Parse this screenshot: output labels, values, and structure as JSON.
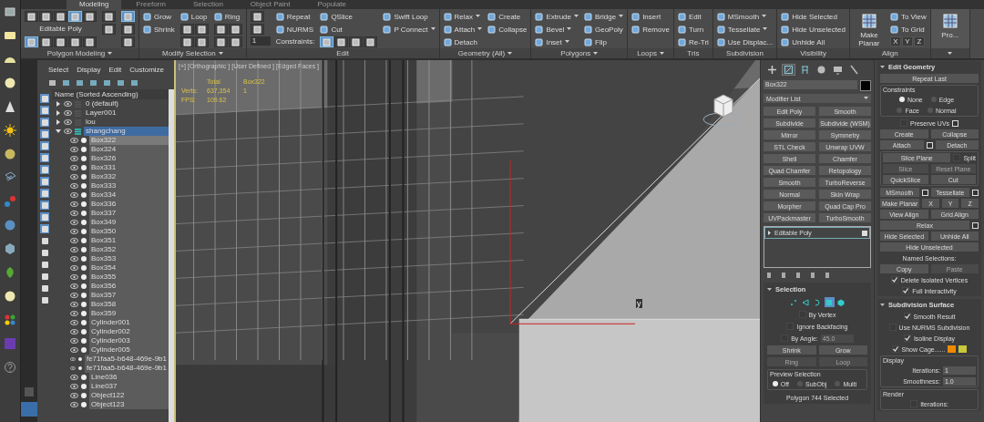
{
  "ribbon": {
    "tabs": [
      {
        "label": "Modeling",
        "selected": true
      },
      {
        "label": "Freeform",
        "selected": false
      },
      {
        "label": "Selection",
        "selected": false
      },
      {
        "label": "Object Paint",
        "selected": false
      },
      {
        "label": "Populate",
        "selected": false
      }
    ],
    "panels": [
      {
        "title": "Polygon Modeling",
        "dropdown": true,
        "columns": [
          [
            {
              "kind": "icons",
              "icons": [
                {
                  "selected": false
                },
                {
                  "selected": false
                },
                {
                  "selected": false
                },
                {
                  "selected": true
                },
                {
                  "selected": false
                }
              ]
            },
            {
              "kind": "text",
              "label": "Editable Poly"
            },
            {
              "kind": "icons",
              "icons": [
                {
                  "selected": true
                },
                {
                  "selected": false
                },
                {
                  "selected": false
                },
                {
                  "selected": false
                },
                {
                  "selected": false
                }
              ]
            }
          ],
          [
            {
              "kind": "icons",
              "icons": [
                {
                  "selected": false
                }
              ]
            },
            {
              "kind": "icons",
              "icons": [
                {
                  "selected": false
                }
              ]
            }
          ],
          [
            {
              "kind": "icons",
              "icons": [
                {
                  "selected": true
                }
              ]
            },
            {
              "kind": "icons",
              "icons": [
                {
                  "selected": false
                }
              ]
            },
            {
              "kind": "icons",
              "icons": [
                {
                  "selected": false
                }
              ]
            }
          ]
        ]
      },
      {
        "title": "Modify Selection",
        "dropdown": true,
        "columns": [
          [
            {
              "kind": "tool",
              "label": "Grow"
            },
            {
              "kind": "tool",
              "label": "Shrink"
            }
          ],
          [
            {
              "kind": "tool",
              "label": "Loop"
            },
            {
              "kind": "icons",
              "icons": [
                {
                  "selected": false
                },
                {
                  "selected": false
                }
              ]
            },
            {
              "kind": "icons",
              "icons": [
                {
                  "selected": false
                },
                {
                  "selected": false
                }
              ]
            }
          ],
          [
            {
              "kind": "tool",
              "label": "Ring"
            },
            {
              "kind": "icons",
              "icons": [
                {
                  "selected": false
                },
                {
                  "selected": false
                }
              ]
            },
            {
              "kind": "icons",
              "icons": [
                {
                  "selected": false
                },
                {
                  "selected": false
                }
              ]
            }
          ]
        ]
      },
      {
        "title": "Edit",
        "columns": [
          [
            {
              "kind": "icons",
              "icons": [
                {
                  "selected": false
                }
              ]
            },
            {
              "kind": "icons",
              "icons": [
                {
                  "selected": false
                }
              ]
            },
            {
              "kind": "spinner",
              "value": "1"
            }
          ],
          [
            {
              "kind": "tool",
              "label": "Repeat"
            },
            {
              "kind": "tool",
              "label": "NURMS"
            },
            {
              "kind": "text",
              "label": "Constraints:"
            }
          ],
          [
            {
              "kind": "tool",
              "label": "QSlice"
            },
            {
              "kind": "tool",
              "label": "Cut"
            },
            {
              "kind": "icons",
              "icons": [
                {
                  "selected": true
                },
                {
                  "selected": false
                },
                {
                  "selected": false
                },
                {
                  "selected": false
                }
              ]
            }
          ],
          [
            {
              "kind": "tool",
              "label": "Swift Loop"
            },
            {
              "kind": "tool",
              "label": "P Connect",
              "dropdown": true
            }
          ]
        ]
      },
      {
        "title": "Geometry (All)",
        "dropdown": true,
        "columns": [
          [
            {
              "kind": "tool",
              "label": "Relax",
              "dropdown": true
            },
            {
              "kind": "tool",
              "label": "Attach",
              "dropdown": true
            },
            {
              "kind": "tool",
              "label": "Detach"
            }
          ],
          [
            {
              "kind": "tool",
              "label": "Create"
            },
            {
              "kind": "tool",
              "label": "Collapse"
            }
          ]
        ]
      },
      {
        "title": "Polygons",
        "dropdown": true,
        "columns": [
          [
            {
              "kind": "tool",
              "label": "Extrude",
              "dropdown": true
            },
            {
              "kind": "tool",
              "label": "Bevel",
              "dropdown": true
            },
            {
              "kind": "tool",
              "label": "Inset",
              "dropdown": true
            }
          ],
          [
            {
              "kind": "tool",
              "label": "Bridge",
              "dropdown": true
            },
            {
              "kind": "tool",
              "label": "GeoPoly"
            },
            {
              "kind": "tool",
              "label": "Flip"
            }
          ]
        ]
      },
      {
        "title": "Loops",
        "dropdown": true,
        "columns": [
          [
            {
              "kind": "tool",
              "label": "Insert"
            },
            {
              "kind": "tool",
              "label": "Remove"
            }
          ]
        ]
      },
      {
        "title": "Tris",
        "columns": [
          [
            {
              "kind": "tool",
              "label": "Edit"
            },
            {
              "kind": "tool",
              "label": "Turn"
            },
            {
              "kind": "tool",
              "label": "Re-Tri"
            }
          ]
        ]
      },
      {
        "title": "Subdivision",
        "columns": [
          [
            {
              "kind": "tool",
              "label": "MSmooth",
              "dropdown": true
            },
            {
              "kind": "tool",
              "label": "Tessellate",
              "dropdown": true
            },
            {
              "kind": "tool",
              "label": "Use Displac..."
            }
          ]
        ]
      },
      {
        "title": "Visibility",
        "columns": [
          [
            {
              "kind": "tool",
              "label": "Hide Selected"
            },
            {
              "kind": "tool",
              "label": "Hide Unselected"
            },
            {
              "kind": "tool",
              "label": "Unhide All"
            }
          ]
        ]
      },
      {
        "title": "Align",
        "columns": [
          [
            {
              "kind": "big",
              "label": "Make Planar"
            }
          ],
          [
            {
              "kind": "tool",
              "label": "To View"
            },
            {
              "kind": "tool",
              "label": "To Grid"
            },
            {
              "kind": "axes",
              "labels": [
                "X",
                "Y",
                "Z"
              ]
            }
          ]
        ]
      },
      {
        "dropdown": true,
        "columns": [
          [
            {
              "kind": "big",
              "label": "Pro..."
            }
          ]
        ]
      }
    ]
  },
  "scene_explorer": {
    "menu": [
      "Select",
      "Display",
      "Edit",
      "Customize"
    ],
    "column_header": "Name (Sorted Ascending)",
    "filters": [
      {
        "on": true
      },
      {
        "on": true
      },
      {
        "on": true
      },
      {
        "on": true
      },
      {
        "on": true
      },
      {
        "on": true
      },
      {
        "on": true
      },
      {
        "on": true
      },
      {
        "on": true
      },
      {
        "on": true
      },
      {
        "on": true
      },
      {
        "on": true
      },
      {
        "on": false
      },
      {
        "on": false
      },
      {
        "on": false
      },
      {
        "on": false
      },
      {
        "on": false
      },
      {
        "on": false
      }
    ],
    "layers": [
      {
        "name": "0 (default)",
        "expanded": false,
        "selected": false
      },
      {
        "name": "Layer001",
        "expanded": false,
        "selected": false
      },
      {
        "name": "lou",
        "expanded": false,
        "selected": false
      },
      {
        "name": "shangchang",
        "expanded": true,
        "selected": true,
        "children": [
          {
            "name": "Box322",
            "selected": true
          },
          {
            "name": "Box324",
            "selected": false
          },
          {
            "name": "Box326",
            "selected": false
          },
          {
            "name": "Box331",
            "selected": false
          },
          {
            "name": "Box332",
            "selected": false
          },
          {
            "name": "Box333",
            "selected": false
          },
          {
            "name": "Box334",
            "selected": false
          },
          {
            "name": "Box336",
            "selected": false
          },
          {
            "name": "Box337",
            "selected": false
          },
          {
            "name": "Box349",
            "selected": false
          },
          {
            "name": "Box350",
            "selected": false
          },
          {
            "name": "Box351",
            "selected": false
          },
          {
            "name": "Box352",
            "selected": false
          },
          {
            "name": "Box353",
            "selected": false
          },
          {
            "name": "Box354",
            "selected": false
          },
          {
            "name": "Box355",
            "selected": false
          },
          {
            "name": "Box356",
            "selected": false
          },
          {
            "name": "Box357",
            "selected": false
          },
          {
            "name": "Box358",
            "selected": false
          },
          {
            "name": "Box359",
            "selected": false
          },
          {
            "name": "Cylinder001",
            "selected": false
          },
          {
            "name": "Cylinder002",
            "selected": false
          },
          {
            "name": "Cylinder003",
            "selected": false
          },
          {
            "name": "Cylinder005",
            "selected": false
          },
          {
            "name": "fe71faa5-b648-469e-9b1",
            "selected": false
          },
          {
            "name": "fe71faa5-b648-469e-9b1",
            "selected": false
          },
          {
            "name": "Line036",
            "selected": false
          },
          {
            "name": "Line037",
            "selected": false
          },
          {
            "name": "Object122",
            "selected": false
          },
          {
            "name": "Object123",
            "selected": false
          }
        ]
      }
    ]
  },
  "viewport": {
    "labels": [
      "[+]",
      "[Orthographic ]",
      "[User Defined ]",
      "[Edged Faces ]"
    ],
    "stats": {
      "headers": [
        "Total",
        "Box322"
      ],
      "rows": [
        {
          "label": "Verts:",
          "values": [
            "637,354",
            "1"
          ]
        },
        {
          "label": "FPS:",
          "values": [
            "109.62"
          ]
        }
      ]
    },
    "axis_label": "y"
  },
  "command_panel": {
    "tabs": [
      {
        "kind": "create",
        "selected": false
      },
      {
        "kind": "modify",
        "selected": true
      },
      {
        "kind": "hierarchy",
        "selected": false
      },
      {
        "kind": "motion",
        "selected": false
      },
      {
        "kind": "display",
        "selected": false
      },
      {
        "kind": "utilities",
        "selected": false
      }
    ],
    "object_name": "Box322",
    "modifier_list": "Modifier List",
    "modifier_buttons": [
      "Edit Poly",
      "Smooth",
      "Subdivide",
      "Subdivide (WSM)",
      "Mirror",
      "Symmetry",
      "STL Check",
      "Unwrap UVW",
      "Shell",
      "Chamfer",
      "Quad Chamfer",
      "Retopology",
      "Smooth",
      "TurboReverse",
      "Normal",
      "Skin Wrap",
      "Morpher",
      "Quad Cap Pro",
      "UVPackmaster",
      "TurboSmooth"
    ],
    "stack": [
      {
        "label": "Editable Poly",
        "expanded": false
      }
    ],
    "selection": {
      "title": "Selection",
      "levels": [
        {
          "kind": "vertex",
          "selected": false
        },
        {
          "kind": "edge",
          "selected": false
        },
        {
          "kind": "border",
          "selected": false
        },
        {
          "kind": "polygon",
          "selected": true
        },
        {
          "kind": "element",
          "selected": false
        }
      ],
      "rows": [
        {
          "kind": "row",
          "items": [
            {
              "kind": "check",
              "label": "By Vertex",
              "checked": false
            }
          ]
        },
        {
          "kind": "row",
          "items": [
            {
              "kind": "check",
              "label": "Ignore Backfacing",
              "checked": false
            }
          ]
        },
        {
          "kind": "row",
          "items": [
            {
              "kind": "check",
              "label": "By Angle:",
              "checked": false
            },
            {
              "kind": "spinner",
              "value": "45.0",
              "disabled": true
            }
          ]
        },
        {
          "kind": "row",
          "items": [
            {
              "kind": "button",
              "label": "Shrink"
            },
            {
              "kind": "button",
              "label": "Grow"
            }
          ]
        },
        {
          "kind": "row",
          "items": [
            {
              "kind": "button",
              "label": "Ring",
              "disabled": true
            },
            {
              "kind": "button",
              "label": "Loop",
              "disabled": true
            }
          ]
        },
        {
          "kind": "frame",
          "title": "Preview Selection",
          "rows": [
            {
              "kind": "row",
              "items": [
                {
                  "kind": "radio",
                  "label": "Off",
                  "selected": true
                },
                {
                  "kind": "radio",
                  "label": "SubObj",
                  "selected": false
                },
                {
                  "kind": "radio",
                  "label": "Multi",
                  "selected": false
                }
              ]
            }
          ]
        },
        {
          "kind": "row",
          "items": [
            {
              "kind": "text",
              "label": "Polygon 744 Selected"
            }
          ]
        }
      ]
    }
  },
  "edit_geometry": {
    "title": "Edit Geometry",
    "rows": [
      {
        "kind": "row",
        "items": [
          {
            "kind": "button",
            "label": "Repeat Last"
          }
        ]
      },
      {
        "kind": "frame",
        "title": "Constraints",
        "rows": [
          {
            "kind": "row",
            "items": [
              {
                "kind": "radio",
                "label": "None",
                "selected": true
              },
              {
                "kind": "radio",
                "label": "Edge",
                "selected": false
              }
            ]
          },
          {
            "kind": "row",
            "items": [
              {
                "kind": "radio",
                "label": "Face",
                "selected": false
              },
              {
                "kind": "radio",
                "label": "Normal",
                "selected": false
              }
            ]
          }
        ]
      },
      {
        "kind": "row",
        "items": [
          {
            "kind": "check",
            "label": "Preserve UVs",
            "checked": false,
            "settings": true
          }
        ]
      },
      {
        "kind": "row",
        "items": [
          {
            "kind": "button",
            "label": "Create"
          },
          {
            "kind": "button",
            "label": "Collapse"
          }
        ]
      },
      {
        "kind": "row",
        "items": [
          {
            "kind": "button",
            "label": "Attach",
            "settings": true
          },
          {
            "kind": "button",
            "label": "Detach"
          }
        ]
      },
      {
        "kind": "frame",
        "rows": [
          {
            "kind": "row",
            "items": [
              {
                "kind": "button",
                "label": "Slice Plane"
              },
              {
                "kind": "check",
                "label": "Split",
                "checked": false
              }
            ]
          },
          {
            "kind": "row",
            "items": [
              {
                "kind": "button",
                "label": "Slice",
                "disabled": true
              },
              {
                "kind": "button",
                "label": "Reset Plane",
                "disabled": true
              }
            ]
          },
          {
            "kind": "row",
            "items": [
              {
                "kind": "button",
                "label": "QuickSlice"
              },
              {
                "kind": "button",
                "label": "Cut"
              }
            ]
          }
        ]
      },
      {
        "kind": "row",
        "items": [
          {
            "kind": "button",
            "label": "MSmooth",
            "settings": true
          },
          {
            "kind": "button",
            "label": "Tessellate",
            "settings": true
          }
        ]
      },
      {
        "kind": "row",
        "items": [
          {
            "kind": "button",
            "label": "Make Planar"
          },
          {
            "kind": "button",
            "label": "X"
          },
          {
            "kind": "button",
            "label": "Y"
          },
          {
            "kind": "button",
            "label": "Z"
          }
        ]
      },
      {
        "kind": "row",
        "items": [
          {
            "kind": "button",
            "label": "View Align"
          },
          {
            "kind": "button",
            "label": "Grid Align"
          }
        ]
      },
      {
        "kind": "row",
        "items": [
          {
            "kind": "button",
            "label": "Relax",
            "settings": true
          }
        ]
      },
      {
        "kind": "row",
        "items": [
          {
            "kind": "button",
            "label": "Hide Selected"
          },
          {
            "kind": "button",
            "label": "Unhide All"
          }
        ]
      },
      {
        "kind": "row",
        "items": [
          {
            "kind": "button",
            "label": "Hide Unselected"
          }
        ]
      },
      {
        "kind": "row",
        "items": [
          {
            "kind": "text",
            "label": "Named Selections:"
          }
        ]
      },
      {
        "kind": "row",
        "items": [
          {
            "kind": "button",
            "label": "Copy"
          },
          {
            "kind": "button",
            "label": "Paste",
            "disabled": true
          }
        ]
      },
      {
        "kind": "row",
        "items": [
          {
            "kind": "check",
            "label": "Delete Isolated Vertices",
            "checked": true
          }
        ]
      },
      {
        "kind": "row",
        "items": [
          {
            "kind": "check",
            "label": "Full Interactivity",
            "checked": true
          }
        ]
      }
    ]
  },
  "subdivision_surface": {
    "title": "Subdivision Surface",
    "rows": [
      {
        "kind": "row",
        "items": [
          {
            "kind": "check",
            "label": "Smooth Result",
            "checked": true
          }
        ]
      },
      {
        "kind": "row",
        "items": [
          {
            "kind": "check",
            "label": "Use NURMS Subdivision",
            "checked": false
          }
        ]
      },
      {
        "kind": "row",
        "items": [
          {
            "kind": "check",
            "label": "Isoline Display",
            "checked": true
          }
        ]
      },
      {
        "kind": "row",
        "items": [
          {
            "kind": "check",
            "label": "Show Cage......",
            "checked": true
          },
          {
            "kind": "swatch",
            "color": "#ef8a00"
          },
          {
            "kind": "swatch",
            "color": "#c9c83a"
          }
        ]
      },
      {
        "kind": "frame",
        "title": "Display",
        "rows": [
          {
            "kind": "row",
            "items": [
              {
                "kind": "spinner",
                "label": "Iterations:",
                "value": "1"
              }
            ]
          },
          {
            "kind": "row",
            "items": [
              {
                "kind": "spinner",
                "label": "Smoothness:",
                "value": "1.0"
              }
            ]
          }
        ]
      },
      {
        "kind": "frame",
        "title": "Render",
        "rows": [
          {
            "kind": "row",
            "items": [
              {
                "kind": "check",
                "label": "Iterations:",
                "checked": false
              }
            ]
          }
        ]
      }
    ]
  }
}
